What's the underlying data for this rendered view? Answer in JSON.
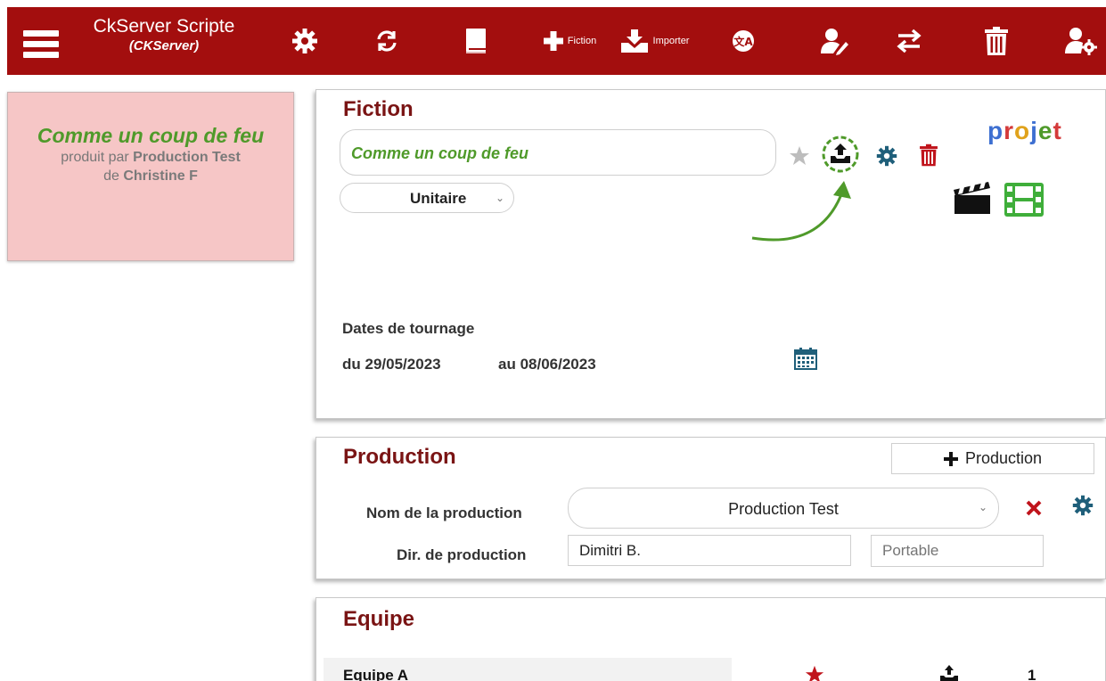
{
  "toolbar": {
    "app_title": "CkServer Scripte",
    "app_subtitle": "(CKServer)",
    "fiction_label": "Fiction",
    "importer_label": "Importer",
    "icons": [
      "menu-icon",
      "gear-icon",
      "refresh-icon",
      "book-icon",
      "plus-icon",
      "import-icon",
      "translate-icon",
      "user-edit-icon",
      "swap-icon",
      "trash-icon",
      "user-settings-icon"
    ]
  },
  "card": {
    "title": "Comme un coup de feu",
    "produced_by_prefix": "produit par",
    "production": "Production Test",
    "author_prefix": "de",
    "author": "Christine F"
  },
  "fiction": {
    "heading": "Fiction",
    "title_value": "Comme un coup de feu",
    "type_value": "Unitaire",
    "projet_label": "projet",
    "dates_label": "Dates de tournage",
    "from_prefix": "du",
    "from_date": "29/05/2023",
    "to_prefix": "au",
    "to_date": "08/06/2023"
  },
  "production": {
    "heading": "Production",
    "add_button": "Production",
    "name_label": "Nom de la production",
    "name_value": "Production Test",
    "director_label": "Dir. de production",
    "director_value": "Dimitri B.",
    "phone_placeholder": "Portable"
  },
  "equipe": {
    "heading": "Equipe",
    "rows": [
      {
        "name": "Equipe A",
        "count": "1"
      }
    ]
  },
  "colors": {
    "toolbar_bg": "#a30e0e",
    "heading": "#7a1414",
    "accent_green": "#4f9a2a",
    "gear_blue": "#1f5f7a",
    "danger_red": "#c0141c",
    "card_bg": "#f6c6c6"
  }
}
